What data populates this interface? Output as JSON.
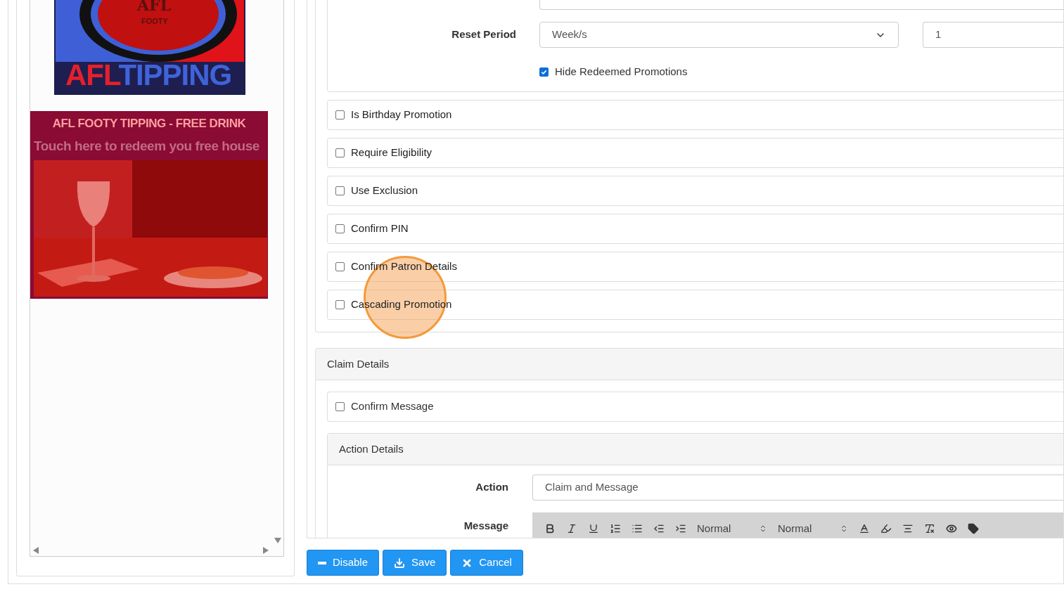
{
  "logo": {
    "ball_title": "AFL",
    "ball_subtitle": "FOOTY",
    "brand_red": "AFL",
    "brand_blue": "TIPPING"
  },
  "promo": {
    "title": "AFL FOOTY TIPPING - FREE DRINK",
    "subtitle": "Touch here to redeem you free house"
  },
  "reset_period": {
    "label": "Reset Period",
    "unit": "Week/s",
    "count": "1"
  },
  "hide_redeemed": {
    "label": "Hide Redeemed Promotions",
    "checked": true
  },
  "options": [
    {
      "label": "Is Birthday Promotion",
      "checked": false
    },
    {
      "label": "Require Eligibility",
      "checked": false
    },
    {
      "label": "Use Exclusion",
      "checked": false
    },
    {
      "label": "Confirm PIN",
      "checked": false
    },
    {
      "label": "Confirm Patron Details",
      "checked": false
    },
    {
      "label": "Cascading Promotion",
      "checked": false
    }
  ],
  "claim_details": {
    "title": "Claim Details",
    "confirm_message": {
      "label": "Confirm Message",
      "checked": false
    },
    "action_details": {
      "title": "Action Details",
      "action_label": "Action",
      "action_value": "Claim and Message",
      "message_label": "Message",
      "toolbar_selects": [
        "Normal",
        "Normal"
      ]
    }
  },
  "buttons": [
    {
      "kind": "disable",
      "label": "Disable"
    },
    {
      "kind": "save",
      "label": "Save"
    },
    {
      "kind": "cancel",
      "label": "Cancel"
    }
  ]
}
